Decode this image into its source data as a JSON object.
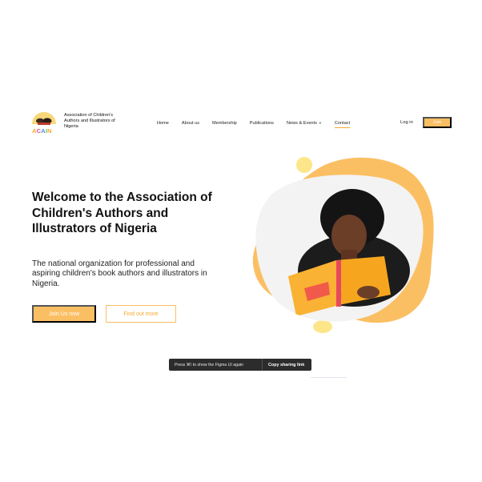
{
  "header": {
    "logo_text": [
      "A",
      "C",
      "A",
      "I",
      "N"
    ],
    "logo_colors": [
      "#f4a72f",
      "#e84c8a",
      "#4a90e2",
      "#6bbf59",
      "#f4a72f"
    ],
    "org_name": "Association of Children's Authors and Illustrators of Nigeria",
    "nav": [
      {
        "label": "Home",
        "active": false
      },
      {
        "label": "About us",
        "active": false
      },
      {
        "label": "Membership",
        "active": false
      },
      {
        "label": "Publications",
        "active": false
      },
      {
        "label": "News & Events",
        "active": false,
        "dropdown": true
      },
      {
        "label": "Contact",
        "active": true
      }
    ],
    "login_label": "Log in",
    "join_label": "Join"
  },
  "hero": {
    "title": "Welcome to the Association of Children's Authors and Illustrators of Nigeria",
    "subtitle": "The national organization for professional and aspiring children's book authors and illustrators in Nigeria.",
    "primary_button": "Join Us now",
    "secondary_button": "Find out more"
  },
  "toast": {
    "message": "Press ⌘\\ to show the Figma UI again",
    "button": "Copy sharing link"
  },
  "colors": {
    "accent": "#fbbf63",
    "accent_dark": "#f4a72f",
    "blob_light": "#fde68a",
    "toast_bg": "#2c2c2c"
  }
}
